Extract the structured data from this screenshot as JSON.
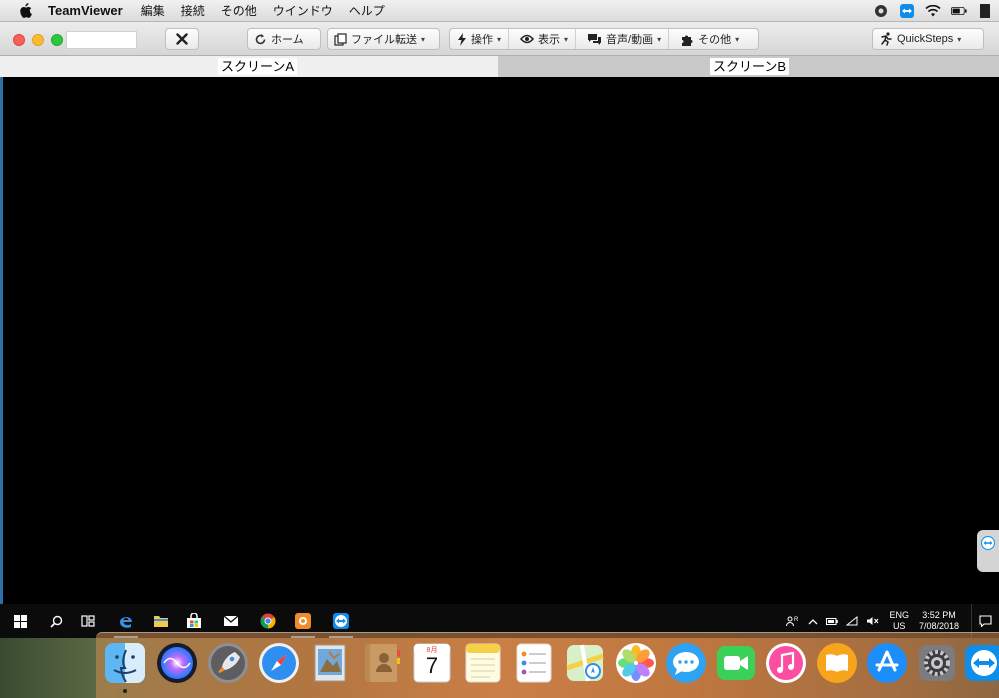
{
  "menubar": {
    "app_name": "TeamViewer",
    "items": [
      "編集",
      "接続",
      "その他",
      "ウインドウ",
      "ヘルプ"
    ]
  },
  "toolbar": {
    "home": "ホーム",
    "file_transfer": "ファイル転送",
    "actions": "操作",
    "view": "表示",
    "audio_video": "音声/動画",
    "extras": "その他",
    "quicksteps": "QuickSteps"
  },
  "tabs": {
    "screen_a": "スクリーンA",
    "screen_b": "スクリーンB"
  },
  "taskbar": {
    "lang_top": "ENG",
    "lang_bottom": "US",
    "time": "3:52 PM",
    "date": "7/08/2018"
  },
  "dock": {
    "calendar_month": "8月",
    "calendar_day": "7"
  },
  "colors": {
    "teamviewer_blue": "#0e8ee9",
    "taskbar": "#0b0b0b",
    "accent": "#76b9ed"
  }
}
